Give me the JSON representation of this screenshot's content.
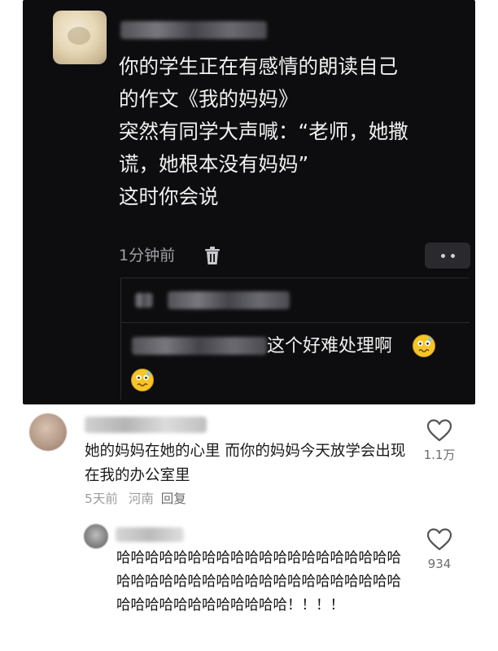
{
  "post": {
    "text": "你的学生正在有感情的朗读自己\n的作文《我的妈妈》\n突然有同学大声喊：“老师，她撒\n谎，她根本没有妈妈”\n这时你会说",
    "timestamp": "1分钟前",
    "reply_text": "这个好难处理啊"
  },
  "comments": [
    {
      "text": "她的妈妈在她的心里 而你的妈妈今天放学会出现在我的办公室里",
      "time": "5天前",
      "location": "河南",
      "reply_label": "回复",
      "likes": "1.1万"
    },
    {
      "text": "哈哈哈哈哈哈哈哈哈哈哈哈哈哈哈哈哈哈哈哈哈哈哈哈哈哈哈哈哈哈哈哈哈哈哈哈哈哈哈哈哈哈哈哈哈哈哈哈哈哈哈哈！！！！",
      "likes": "934"
    }
  ],
  "colors": {
    "dark_bg": "#0d0d0f",
    "dark_text": "#f1f1f1",
    "muted": "#a0a0a6"
  }
}
